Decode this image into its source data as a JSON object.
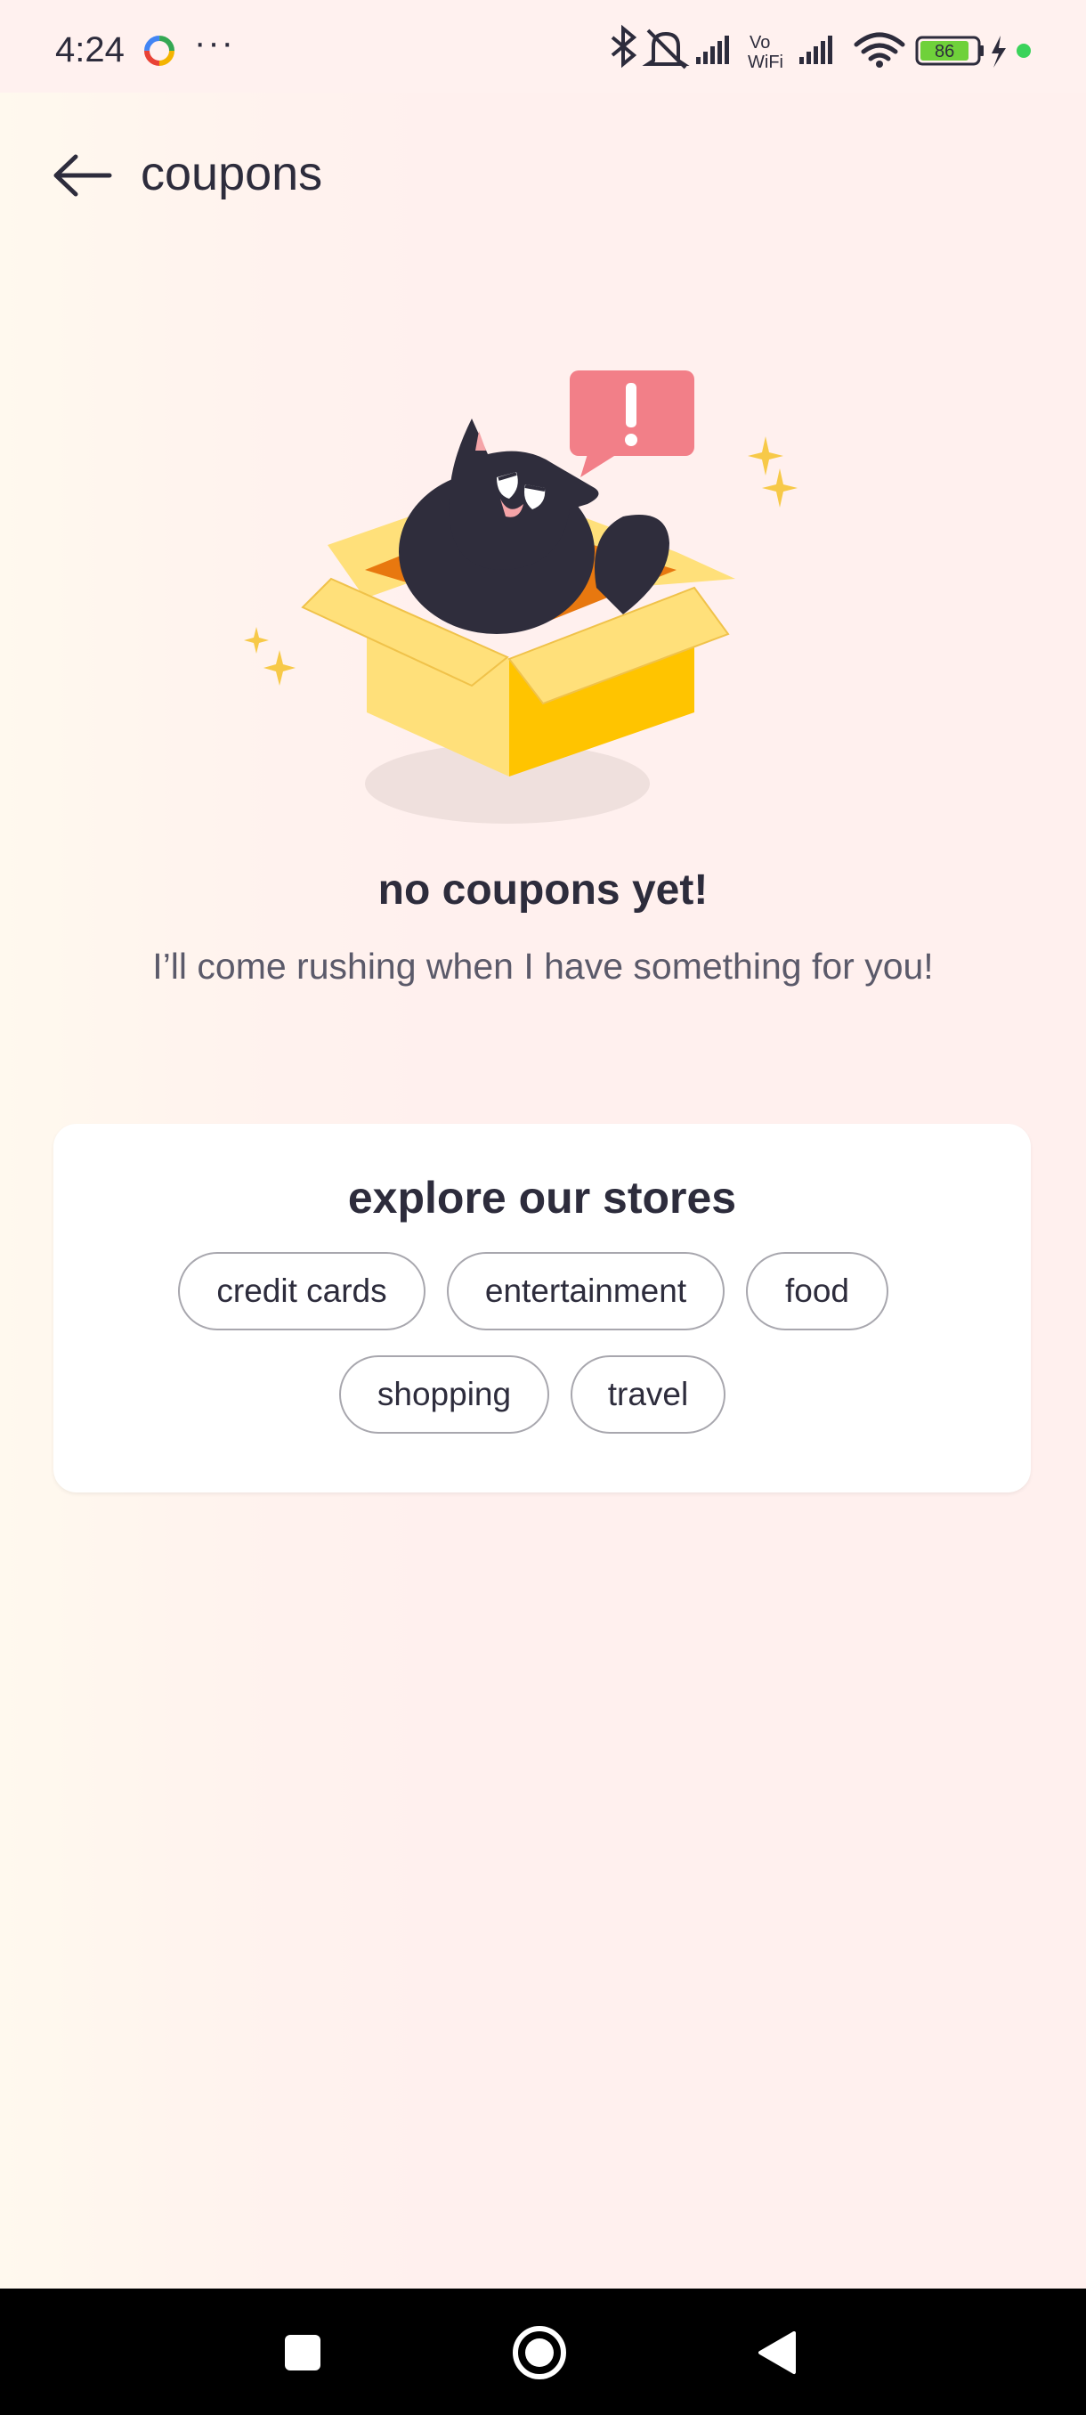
{
  "status_bar": {
    "time": "4:24",
    "more": "···",
    "battery": "86",
    "network": "VoWiFi"
  },
  "header": {
    "title": "coupons",
    "back_icon": "arrow-left-icon"
  },
  "empty_state": {
    "title": "no coupons yet!",
    "subtitle": "I’ll come rushing when I have something for you!",
    "illustration": "cat-in-box"
  },
  "stores": {
    "title": "explore our stores",
    "categories": [
      "credit cards",
      "entertainment",
      "food",
      "shopping",
      "travel"
    ]
  },
  "nav": {
    "recents": "square-icon",
    "home": "circle-icon",
    "back": "triangle-back-icon"
  },
  "colors": {
    "text": "#2d2c3c",
    "box_yellow": "#ffd54a",
    "alert_pink": "#f27f88",
    "chip_border": "#a8a7ae"
  }
}
